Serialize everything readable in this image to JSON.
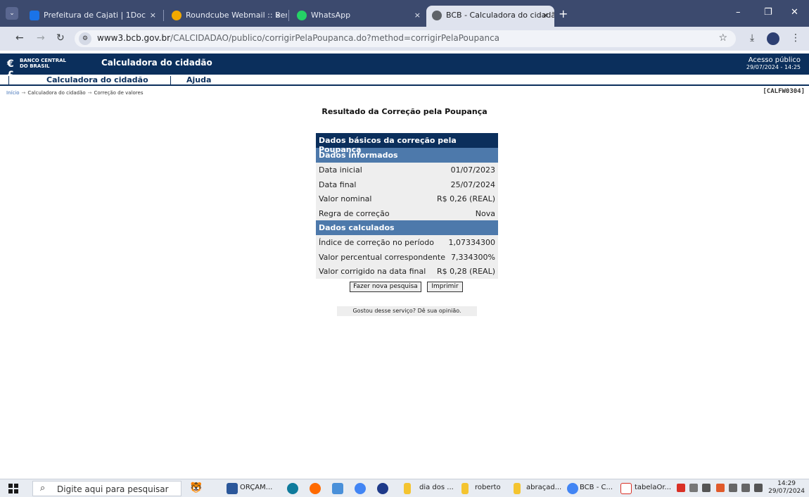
{
  "browser": {
    "tabs": [
      {
        "title": "Prefeitura de Cajati | 1Doc",
        "icon": "doc-icon",
        "color": "#1a73e8"
      },
      {
        "title": "Roundcube Webmail :: Bem-vin",
        "icon": "roundcube-icon",
        "color": "#f2a900"
      },
      {
        "title": "WhatsApp",
        "icon": "whatsapp-icon",
        "color": "#25d366"
      },
      {
        "title": "BCB - Calculadora do cidadão",
        "icon": "globe-icon",
        "color": "#5f6368",
        "active": true
      }
    ],
    "close_glyph": "×",
    "new_tab_glyph": "+",
    "url_host": "www3.bcb.gov.br",
    "url_path": "/CALCIDADAO/publico/corrigirPelaPoupanca.do?method=corrigirPelaPoupanca"
  },
  "header": {
    "logo_mark": "€£",
    "logo_text_line1": "BANCO CENTRAL",
    "logo_text_line2": "DO BRASIL",
    "title": "Calculadora do cidadão",
    "access_label": "Acesso público",
    "access_datetime": "29/07/2024 - 14:25",
    "brand_color": "#0b2f5c"
  },
  "menu": {
    "items": [
      "Calculadora do cidadão",
      "Ajuda"
    ]
  },
  "breadcrumb": {
    "items": [
      "Início",
      "Calculadora do cidadão",
      "Correção de valores"
    ],
    "separator": "→",
    "screen_code": "[CALFW0304]"
  },
  "result": {
    "title": "Resultado da Correção pela Poupança",
    "table_header": "Dados básicos da correção pela Poupança",
    "section_informed": "Dados informados",
    "informed_rows": [
      {
        "label": "Data inicial",
        "value": "01/07/2023"
      },
      {
        "label": "Data final",
        "value": "25/07/2024"
      },
      {
        "label": "Valor nominal",
        "value": "R$ 0,26 (REAL)"
      },
      {
        "label": "Regra de correção",
        "value": "Nova"
      }
    ],
    "section_calculated": "Dados calculados",
    "calculated_rows": [
      {
        "label": "Índice de correção no período",
        "value": "1,07334300"
      },
      {
        "label": "Valor percentual correspondente",
        "value": "7,334300%"
      },
      {
        "label": "Valor corrigido na data final",
        "value": "R$ 0,28 (REAL)"
      }
    ],
    "new_search_button": "Fazer nova pesquisa",
    "print_button": "Imprimir",
    "feedback_text": "Gostou desse serviço? Dê sua opinião."
  },
  "taskbar": {
    "search_placeholder": "Digite aqui para pesquisar",
    "apps": [
      {
        "label": "ORÇAM...",
        "icon": "word-icon",
        "color": "#2b579a"
      },
      {
        "label": "dia dos ...",
        "icon": "folder-icon",
        "color": "#f4c430"
      },
      {
        "label": "roberto",
        "icon": "folder-icon",
        "color": "#f4c430"
      },
      {
        "label": "abraçad...",
        "icon": "folder-icon",
        "color": "#f4c430"
      },
      {
        "label": "BCB - C...",
        "icon": "chrome-icon",
        "color": "#4285f4"
      },
      {
        "label": "tabelaOr...",
        "icon": "pdf-icon",
        "color": "#d93025"
      }
    ],
    "time": "14:29",
    "date": "29/07/2024"
  }
}
